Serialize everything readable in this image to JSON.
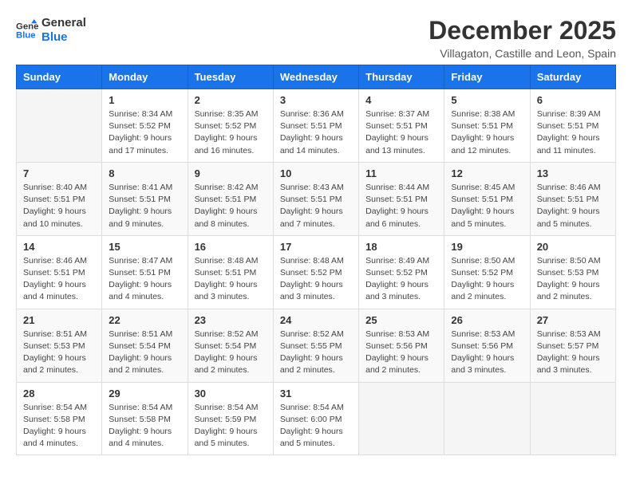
{
  "logo": {
    "line1": "General",
    "line2": "Blue"
  },
  "title": "December 2025",
  "location": "Villagaton, Castille and Leon, Spain",
  "days_header": [
    "Sunday",
    "Monday",
    "Tuesday",
    "Wednesday",
    "Thursday",
    "Friday",
    "Saturday"
  ],
  "weeks": [
    [
      {
        "num": "",
        "sunrise": "",
        "sunset": "",
        "daylight": ""
      },
      {
        "num": "1",
        "sunrise": "Sunrise: 8:34 AM",
        "sunset": "Sunset: 5:52 PM",
        "daylight": "Daylight: 9 hours and 17 minutes."
      },
      {
        "num": "2",
        "sunrise": "Sunrise: 8:35 AM",
        "sunset": "Sunset: 5:52 PM",
        "daylight": "Daylight: 9 hours and 16 minutes."
      },
      {
        "num": "3",
        "sunrise": "Sunrise: 8:36 AM",
        "sunset": "Sunset: 5:51 PM",
        "daylight": "Daylight: 9 hours and 14 minutes."
      },
      {
        "num": "4",
        "sunrise": "Sunrise: 8:37 AM",
        "sunset": "Sunset: 5:51 PM",
        "daylight": "Daylight: 9 hours and 13 minutes."
      },
      {
        "num": "5",
        "sunrise": "Sunrise: 8:38 AM",
        "sunset": "Sunset: 5:51 PM",
        "daylight": "Daylight: 9 hours and 12 minutes."
      },
      {
        "num": "6",
        "sunrise": "Sunrise: 8:39 AM",
        "sunset": "Sunset: 5:51 PM",
        "daylight": "Daylight: 9 hours and 11 minutes."
      }
    ],
    [
      {
        "num": "7",
        "sunrise": "Sunrise: 8:40 AM",
        "sunset": "Sunset: 5:51 PM",
        "daylight": "Daylight: 9 hours and 10 minutes."
      },
      {
        "num": "8",
        "sunrise": "Sunrise: 8:41 AM",
        "sunset": "Sunset: 5:51 PM",
        "daylight": "Daylight: 9 hours and 9 minutes."
      },
      {
        "num": "9",
        "sunrise": "Sunrise: 8:42 AM",
        "sunset": "Sunset: 5:51 PM",
        "daylight": "Daylight: 9 hours and 8 minutes."
      },
      {
        "num": "10",
        "sunrise": "Sunrise: 8:43 AM",
        "sunset": "Sunset: 5:51 PM",
        "daylight": "Daylight: 9 hours and 7 minutes."
      },
      {
        "num": "11",
        "sunrise": "Sunrise: 8:44 AM",
        "sunset": "Sunset: 5:51 PM",
        "daylight": "Daylight: 9 hours and 6 minutes."
      },
      {
        "num": "12",
        "sunrise": "Sunrise: 8:45 AM",
        "sunset": "Sunset: 5:51 PM",
        "daylight": "Daylight: 9 hours and 5 minutes."
      },
      {
        "num": "13",
        "sunrise": "Sunrise: 8:46 AM",
        "sunset": "Sunset: 5:51 PM",
        "daylight": "Daylight: 9 hours and 5 minutes."
      }
    ],
    [
      {
        "num": "14",
        "sunrise": "Sunrise: 8:46 AM",
        "sunset": "Sunset: 5:51 PM",
        "daylight": "Daylight: 9 hours and 4 minutes."
      },
      {
        "num": "15",
        "sunrise": "Sunrise: 8:47 AM",
        "sunset": "Sunset: 5:51 PM",
        "daylight": "Daylight: 9 hours and 4 minutes."
      },
      {
        "num": "16",
        "sunrise": "Sunrise: 8:48 AM",
        "sunset": "Sunset: 5:51 PM",
        "daylight": "Daylight: 9 hours and 3 minutes."
      },
      {
        "num": "17",
        "sunrise": "Sunrise: 8:48 AM",
        "sunset": "Sunset: 5:52 PM",
        "daylight": "Daylight: 9 hours and 3 minutes."
      },
      {
        "num": "18",
        "sunrise": "Sunrise: 8:49 AM",
        "sunset": "Sunset: 5:52 PM",
        "daylight": "Daylight: 9 hours and 3 minutes."
      },
      {
        "num": "19",
        "sunrise": "Sunrise: 8:50 AM",
        "sunset": "Sunset: 5:52 PM",
        "daylight": "Daylight: 9 hours and 2 minutes."
      },
      {
        "num": "20",
        "sunrise": "Sunrise: 8:50 AM",
        "sunset": "Sunset: 5:53 PM",
        "daylight": "Daylight: 9 hours and 2 minutes."
      }
    ],
    [
      {
        "num": "21",
        "sunrise": "Sunrise: 8:51 AM",
        "sunset": "Sunset: 5:53 PM",
        "daylight": "Daylight: 9 hours and 2 minutes."
      },
      {
        "num": "22",
        "sunrise": "Sunrise: 8:51 AM",
        "sunset": "Sunset: 5:54 PM",
        "daylight": "Daylight: 9 hours and 2 minutes."
      },
      {
        "num": "23",
        "sunrise": "Sunrise: 8:52 AM",
        "sunset": "Sunset: 5:54 PM",
        "daylight": "Daylight: 9 hours and 2 minutes."
      },
      {
        "num": "24",
        "sunrise": "Sunrise: 8:52 AM",
        "sunset": "Sunset: 5:55 PM",
        "daylight": "Daylight: 9 hours and 2 minutes."
      },
      {
        "num": "25",
        "sunrise": "Sunrise: 8:53 AM",
        "sunset": "Sunset: 5:56 PM",
        "daylight": "Daylight: 9 hours and 2 minutes."
      },
      {
        "num": "26",
        "sunrise": "Sunrise: 8:53 AM",
        "sunset": "Sunset: 5:56 PM",
        "daylight": "Daylight: 9 hours and 3 minutes."
      },
      {
        "num": "27",
        "sunrise": "Sunrise: 8:53 AM",
        "sunset": "Sunset: 5:57 PM",
        "daylight": "Daylight: 9 hours and 3 minutes."
      }
    ],
    [
      {
        "num": "28",
        "sunrise": "Sunrise: 8:54 AM",
        "sunset": "Sunset: 5:58 PM",
        "daylight": "Daylight: 9 hours and 4 minutes."
      },
      {
        "num": "29",
        "sunrise": "Sunrise: 8:54 AM",
        "sunset": "Sunset: 5:58 PM",
        "daylight": "Daylight: 9 hours and 4 minutes."
      },
      {
        "num": "30",
        "sunrise": "Sunrise: 8:54 AM",
        "sunset": "Sunset: 5:59 PM",
        "daylight": "Daylight: 9 hours and 5 minutes."
      },
      {
        "num": "31",
        "sunrise": "Sunrise: 8:54 AM",
        "sunset": "Sunset: 6:00 PM",
        "daylight": "Daylight: 9 hours and 5 minutes."
      },
      {
        "num": "",
        "sunrise": "",
        "sunset": "",
        "daylight": ""
      },
      {
        "num": "",
        "sunrise": "",
        "sunset": "",
        "daylight": ""
      },
      {
        "num": "",
        "sunrise": "",
        "sunset": "",
        "daylight": ""
      }
    ]
  ]
}
